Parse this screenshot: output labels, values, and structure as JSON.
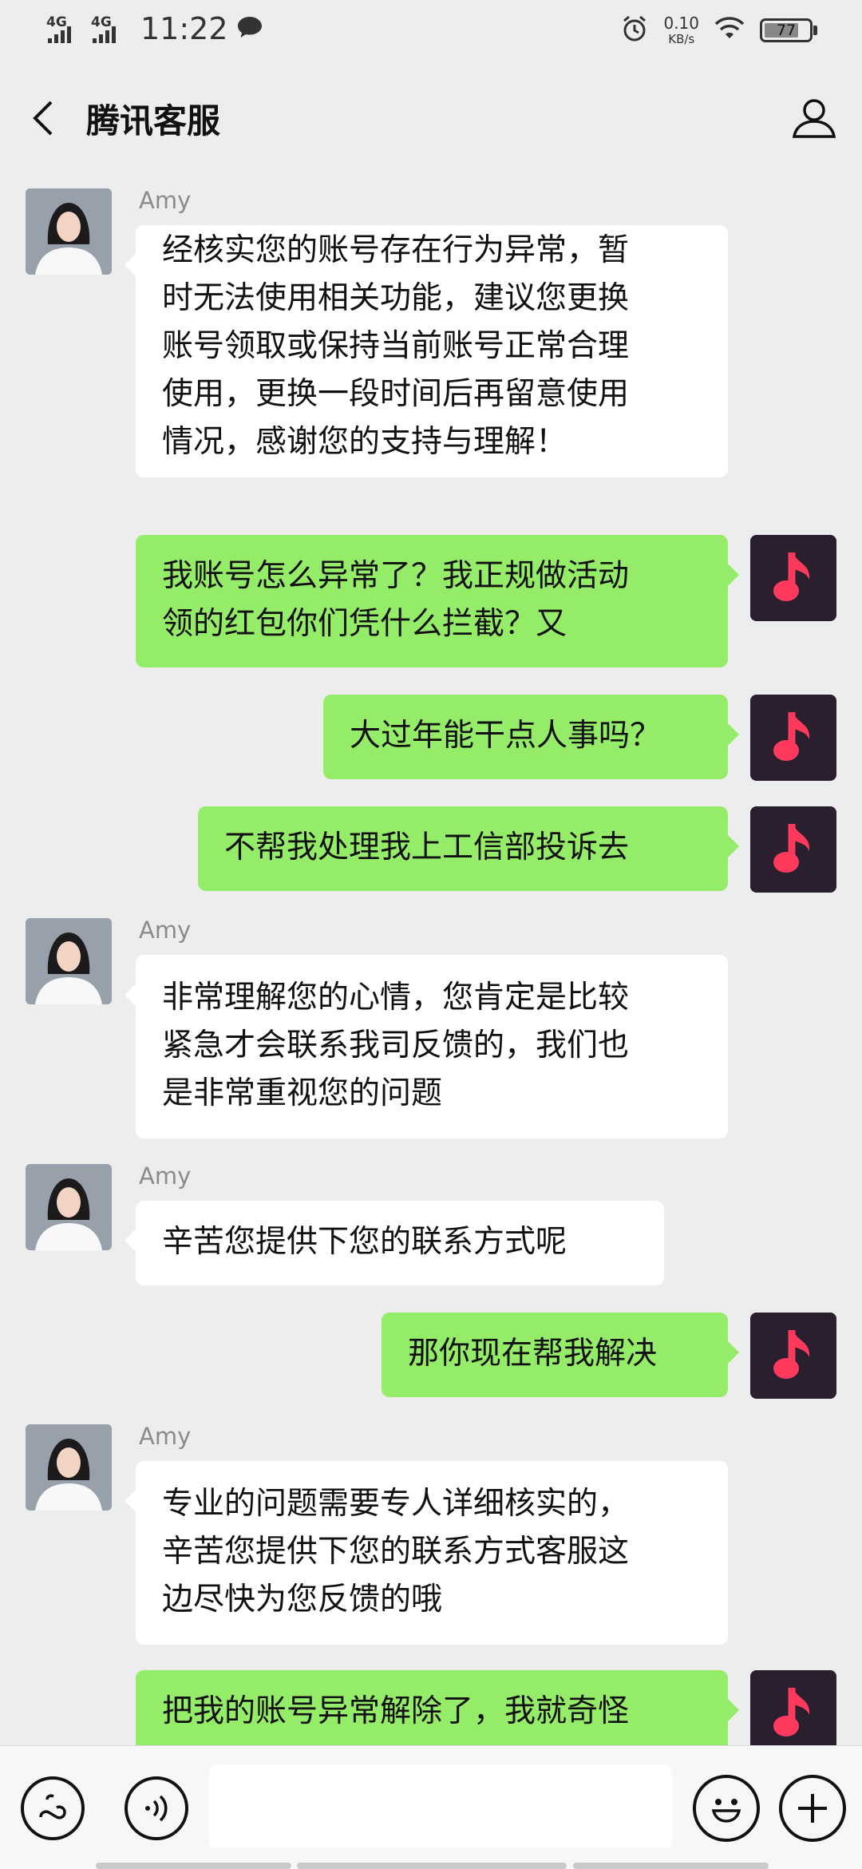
{
  "status_bar": {
    "network_1": "4G",
    "network_2": "4G",
    "time": "11:22",
    "speed_value": "0.10",
    "speed_unit": "KB/s",
    "battery": "77"
  },
  "header": {
    "title": "腾讯客服",
    "back_icon": "chevron-left-icon",
    "profile_icon": "person-icon"
  },
  "messages": [
    {
      "from": "agent",
      "sender": "Amy",
      "text": "经核实您的账号存在行为异常，暂\n时无法使用相关功能，建议您更换\n账号领取或保持当前账号正常合理\n使用，更换一段时间后再留意使用\n情况，感谢您的支持与理解！"
    },
    {
      "from": "me",
      "text": "我账号怎么异常了？我正规做活动\n领的红包你们凭什么拦截？又"
    },
    {
      "from": "me",
      "text": "大过年能干点人事吗？"
    },
    {
      "from": "me",
      "text": "不帮我处理我上工信部投诉去"
    },
    {
      "from": "agent",
      "sender": "Amy",
      "text": "非常理解您的心情，您肯定是比较\n紧急才会联系我司反馈的，我们也\n是非常重视您的问题"
    },
    {
      "from": "agent",
      "sender": "Amy",
      "text": "辛苦您提供下您的联系方式呢"
    },
    {
      "from": "me",
      "text": "那你现在帮我解决"
    },
    {
      "from": "agent",
      "sender": "Amy",
      "text": "专业的问题需要专人详细核实的，\n辛苦您提供下您的联系方式客服这\n边尽快为您反馈的哦"
    },
    {
      "from": "me",
      "text": "把我的账号异常解除了，我就奇怪"
    }
  ],
  "bottom_bar": {
    "left_icon": "link-icon",
    "voice_icon": "voice-icon",
    "emoji_icon": "emoji-icon",
    "plus_icon": "plus-icon"
  },
  "colors": {
    "background": "#ededed",
    "outgoing_bubble": "#95ec69",
    "incoming_bubble": "#ffffff",
    "me_avatar": "#2a1f2e",
    "note_icon": "#ff3a5c"
  }
}
